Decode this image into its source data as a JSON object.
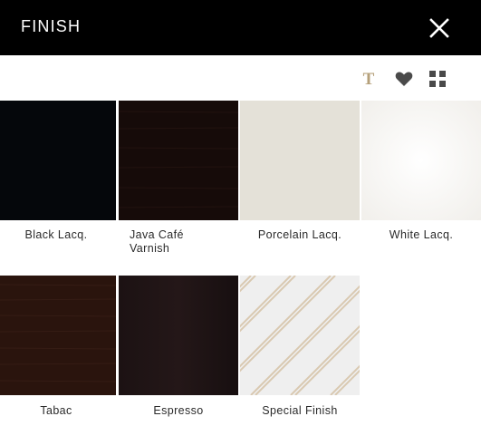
{
  "header": {
    "title": "FINISH",
    "background": "#000000",
    "close_icon": "close-icon"
  },
  "toolbar": {
    "text_icon_glyph": "T",
    "icons": [
      "text-filter-icon",
      "heart-icon",
      "grid-icon"
    ],
    "accent_color": "#b5a07a"
  },
  "finishes": [
    {
      "label": "Black Lacq.",
      "color": "#05070b"
    },
    {
      "label": "Java Café Varnish",
      "label_line1": "Java Café",
      "label_line2": "Varnish",
      "color": "#160b09"
    },
    {
      "label": "Porcelain Lacq.",
      "color": "#e4e1d8"
    },
    {
      "label": "White Lacq.",
      "color": "#f7f6f3"
    },
    {
      "label": "Tabac",
      "color": "#2a140d"
    },
    {
      "label": "Espresso",
      "color": "#1a1112"
    },
    {
      "label": "Special Finish",
      "color": "#efefef",
      "stripe_color": "#d9c9b1"
    }
  ]
}
